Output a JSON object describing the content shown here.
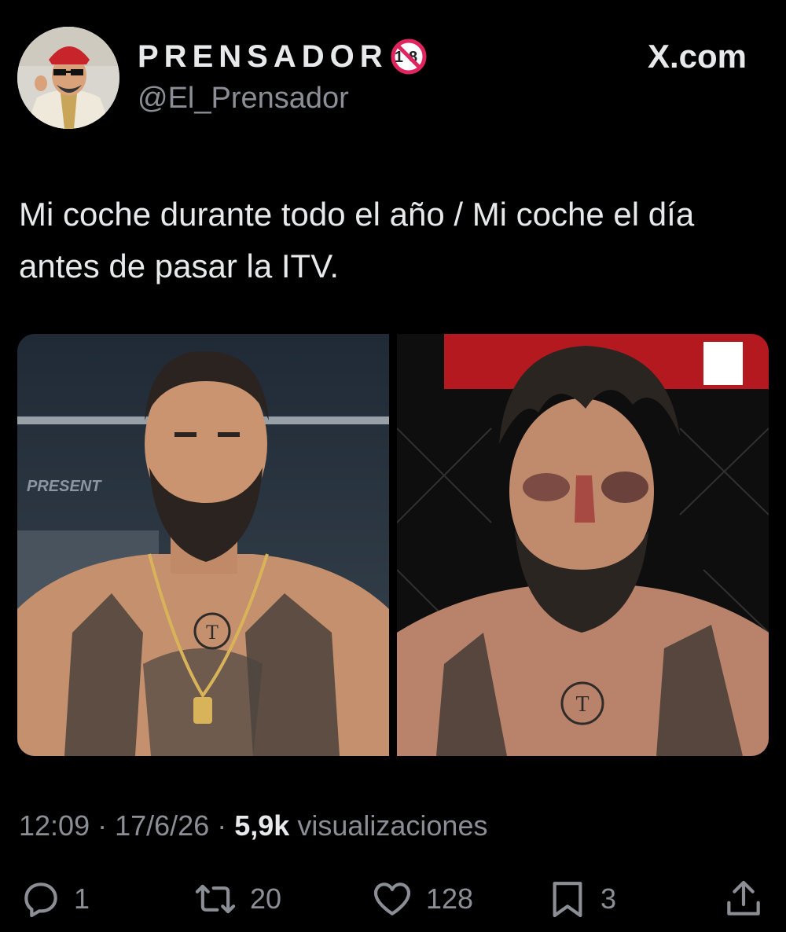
{
  "author": {
    "display_name": "PRENSADOR",
    "handle": "@El_Prensador",
    "badge": "18"
  },
  "brand": {
    "label": "X.com"
  },
  "tweet": {
    "text": "Mi coche durante todo el año / Mi coche el día antes de pasar la ITV.",
    "time": "12:09",
    "date": "17/6/26",
    "views_count": "5,9k",
    "views_label": "visualizaciones"
  },
  "media": [
    {
      "name": "left-photo",
      "description_icon": "fighter-before-photo"
    },
    {
      "name": "right-photo",
      "description_icon": "fighter-after-photo"
    }
  ],
  "actions": {
    "replies": "1",
    "reposts": "20",
    "likes": "128",
    "bookmarks": "3"
  },
  "colors": {
    "background": "#000000",
    "text": "#e7e9ea",
    "secondary": "#8b8f95",
    "badge_red": "#e0245e"
  }
}
